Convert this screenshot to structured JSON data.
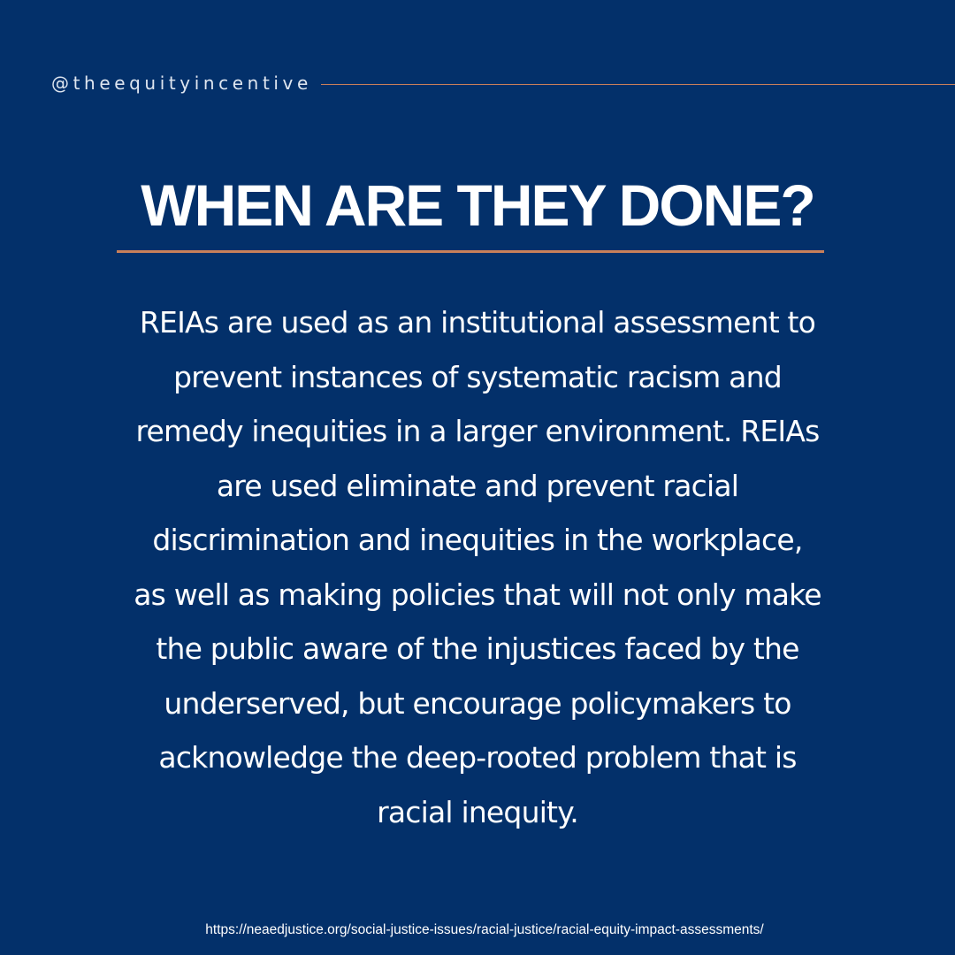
{
  "header": {
    "handle": "@theequityincentive"
  },
  "title": "WHEN ARE THEY DONE?",
  "body": {
    "lines": [
      "REIAs are used as an institutional assessment to",
      "prevent instances of systematic racism and",
      "remedy inequities in a larger environment. REIAs",
      "are used eliminate and prevent racial",
      "discrimination and inequities in the workplace,",
      "as well as making policies that will not only make",
      "the public aware of the injustices faced by the",
      "underserved, but encourage policymakers to",
      "acknowledge the deep-rooted problem that is",
      "racial inequity."
    ]
  },
  "footer": {
    "source_url": "https://neaedjustice.org/social-justice-issues/racial-justice/racial-equity-impact-assessments/"
  },
  "colors": {
    "background": "#03306a",
    "accent": "#c9805a",
    "text": "#ffffff"
  }
}
